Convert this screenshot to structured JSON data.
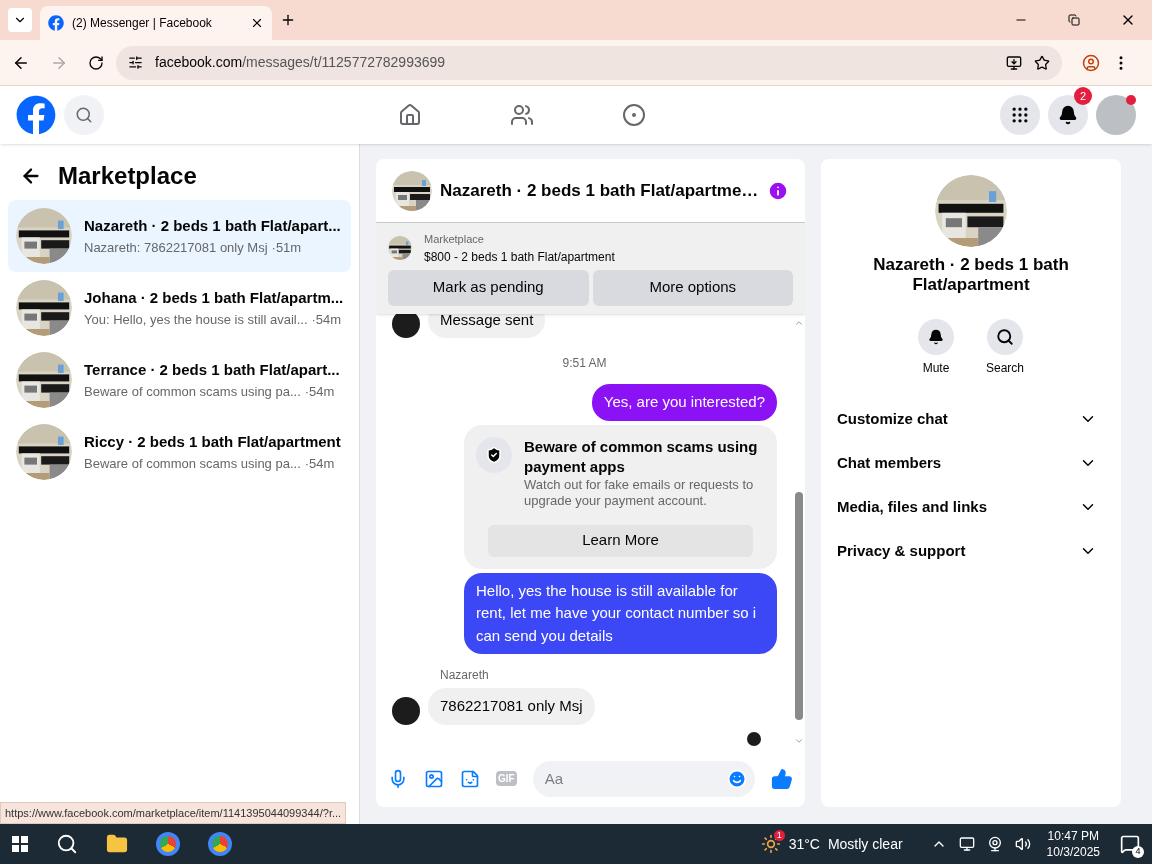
{
  "browser": {
    "tab_title": "(2) Messenger | Facebook",
    "url_host": "facebook.com",
    "url_path": "/messages/t/1125772782993699"
  },
  "header": {
    "notification_count": "2"
  },
  "sidebar": {
    "title": "Marketplace",
    "items": [
      {
        "title": "Nazareth · 2 beds 1 bath Flat/apart...",
        "preview": "Nazareth: 7862217081 only Msj",
        "time": "·51m",
        "selected": true
      },
      {
        "title": "Johana · 2 beds 1 bath Flat/apartm...",
        "preview": "You: Hello, yes the house is still avail...",
        "time": "·54m",
        "selected": false
      },
      {
        "title": "Terrance · 2 beds 1 bath Flat/apart...",
        "preview": "Beware of common scams using pa...",
        "time": "·54m",
        "selected": false
      },
      {
        "title": "Riccy · 2 beds 1 bath Flat/apartment",
        "preview": "Beware of common scams using pa...",
        "time": "·54m",
        "selected": false
      }
    ]
  },
  "chat": {
    "title": "Nazareth · 2 beds 1 bath Flat/apartme…",
    "listing": {
      "label": "Marketplace",
      "title": "$800 - 2 beds 1 bath Flat/apartment",
      "buttons": [
        "Mark as pending",
        "More options"
      ]
    },
    "messages": [
      {
        "kind": "incoming",
        "text": "Message sent",
        "avatar": true
      },
      {
        "kind": "timestamp",
        "text": "9:51 AM"
      },
      {
        "kind": "outgoing",
        "text": "Yes, are you interested?",
        "color": "#8a12f5"
      },
      {
        "kind": "notice",
        "title": "Beware of common scams using payment apps",
        "body": "Watch out for fake emails or requests to upgrade your payment account.",
        "button": "Learn More"
      },
      {
        "kind": "outgoing",
        "text": "Hello, yes the house is still available for rent, let me have your contact number so i can send you details",
        "color": "#3c47f5"
      },
      {
        "kind": "sender",
        "text": "Nazareth"
      },
      {
        "kind": "incoming",
        "text": "7862217081 only Msj",
        "avatar": true
      },
      {
        "kind": "seen"
      }
    ],
    "composer": {
      "gif_label": "GIF",
      "placeholder": "Aa"
    }
  },
  "details": {
    "title": "Nazareth · 2 beds 1 bath Flat/apartment",
    "actions": [
      "Mute",
      "Search"
    ],
    "sections": [
      {
        "label": "Customize chat",
        "expanded": false
      },
      {
        "label": "Chat members",
        "expanded": false
      },
      {
        "label": "Media, files and links",
        "expanded": false
      },
      {
        "label": "Privacy & support",
        "expanded": false
      }
    ]
  },
  "status_url": "https://www.facebook.com/marketplace/item/1141395044099344/?r...",
  "taskbar": {
    "weather_badge": "1",
    "temperature": "31°C",
    "weather": "Mostly clear",
    "time": "10:47 PM",
    "date": "10/3/2025",
    "notifications": "4"
  }
}
